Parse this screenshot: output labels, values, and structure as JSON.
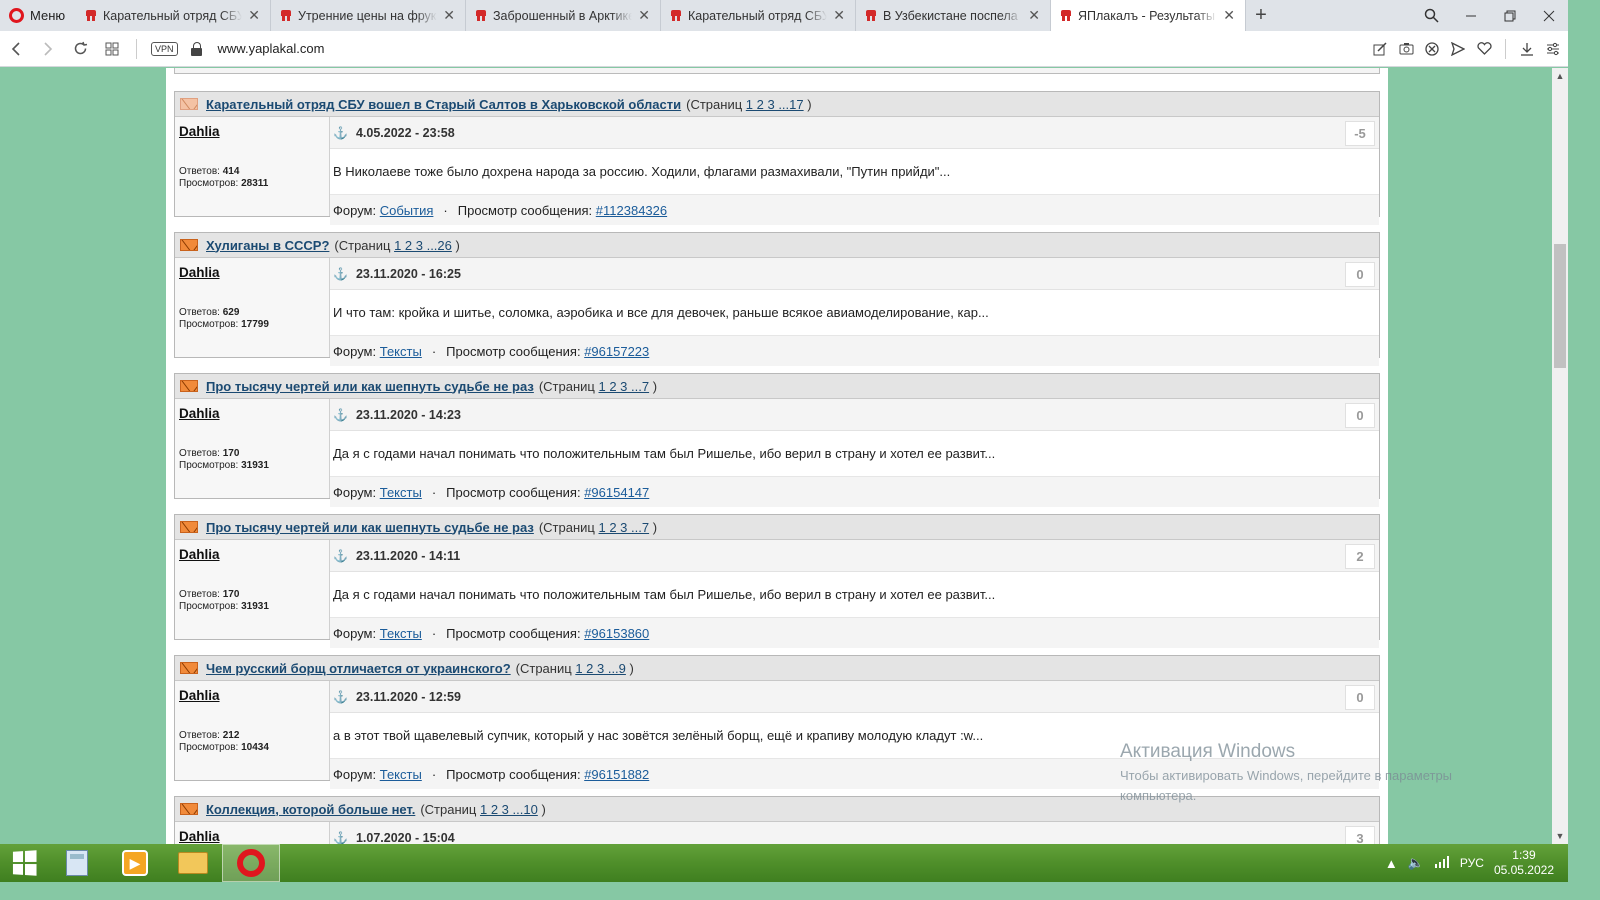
{
  "browser": {
    "menu_label": "Меню",
    "tabs": [
      {
        "title": "Карательный отряд СБУ в",
        "active": false
      },
      {
        "title": "Утренние цены на фрукты",
        "active": false
      },
      {
        "title": "Заброшенный в Арктике",
        "active": false
      },
      {
        "title": "Карательный отряд СБУ в",
        "active": false
      },
      {
        "title": "В Узбекистане поспела по",
        "active": false
      },
      {
        "title": "ЯПлакалъ - Результаты по",
        "active": true
      }
    ],
    "vpn_label": "VPN",
    "url": "www.yaplakal.com"
  },
  "posts": [
    {
      "title": "Карательный отряд СБУ вошел в Старый Салтов в Харьковской области",
      "pages_prefix": "(Страниц",
      "pages": "1 2 3 ...17",
      "pages_suffix": ")",
      "author": "Dahlia",
      "date": "4.05.2022 - 23:58",
      "rating": "-5",
      "replies_label": "Ответов:",
      "replies": "414",
      "views_label": "Просмотров:",
      "views": "28311",
      "text": "В Николаеве тоже было дохрена народа за россию. Ходили, флагами размахивали, \"Путин прийди\"...",
      "forum_label": "Форум:",
      "forum": "События",
      "msg_label": "Просмотр сообщения:",
      "msg_id": "#112384326",
      "icon": "envelope-read"
    },
    {
      "title": "Хулиганы в СССР?",
      "pages_prefix": "(Страниц",
      "pages": "1 2 3 ...26",
      "pages_suffix": ")",
      "author": "Dahlia",
      "date": "23.11.2020 - 16:25",
      "rating": "0",
      "replies_label": "Ответов:",
      "replies": "629",
      "views_label": "Просмотров:",
      "views": "17799",
      "text": "И что там: кройка и шитье, соломка, аэробика и все для девочек, раньше всякое авиамоделирование, кар...",
      "forum_label": "Форум:",
      "forum": "Тексты",
      "msg_label": "Просмотр сообщения:",
      "msg_id": "#96157223",
      "icon": "envelope"
    },
    {
      "title": "Про тысячу чертей или как шепнуть судьбе не раз",
      "pages_prefix": "(Страниц",
      "pages": "1 2 3 ...7",
      "pages_suffix": ")",
      "author": "Dahlia",
      "date": "23.11.2020 - 14:23",
      "rating": "0",
      "replies_label": "Ответов:",
      "replies": "170",
      "views_label": "Просмотров:",
      "views": "31931",
      "text": "Да я с годами начал понимать что положительным там был Ришелье, ибо верил в страну и хотел ее развит...",
      "forum_label": "Форум:",
      "forum": "Тексты",
      "msg_label": "Просмотр сообщения:",
      "msg_id": "#96154147",
      "icon": "envelope"
    },
    {
      "title": "Про тысячу чертей или как шепнуть судьбе не раз",
      "pages_prefix": "(Страниц",
      "pages": "1 2 3 ...7",
      "pages_suffix": ")",
      "author": "Dahlia",
      "date": "23.11.2020 - 14:11",
      "rating": "2",
      "replies_label": "Ответов:",
      "replies": "170",
      "views_label": "Просмотров:",
      "views": "31931",
      "text": "Да я с годами начал понимать что положительным там был Ришелье, ибо верил в страну и хотел ее развит...",
      "forum_label": "Форум:",
      "forum": "Тексты",
      "msg_label": "Просмотр сообщения:",
      "msg_id": "#96153860",
      "icon": "envelope"
    },
    {
      "title": "Чем русский борщ отличается от украинского?",
      "pages_prefix": "(Страниц",
      "pages": "1 2 3 ...9",
      "pages_suffix": ")",
      "author": "Dahlia",
      "date": "23.11.2020 - 12:59",
      "rating": "0",
      "replies_label": "Ответов:",
      "replies": "212",
      "views_label": "Просмотров:",
      "views": "10434",
      "text": "а в этот твой щавелевый супчик, который у нас зовётся зелёный борщ, ещё и крапиву молодую кладут :w...",
      "forum_label": "Форум:",
      "forum": "Тексты",
      "msg_label": "Просмотр сообщения:",
      "msg_id": "#96151882",
      "icon": "envelope"
    },
    {
      "title": "Коллекция, которой больше нет.",
      "pages_prefix": "(Страниц",
      "pages": "1 2 3 ...10",
      "pages_suffix": ")",
      "author": "Dahlia",
      "date": "1.07.2020 - 15:04",
      "rating": "3",
      "icon": "envelope"
    }
  ],
  "watermark": {
    "title": "Активация Windows",
    "subtitle": "Чтобы активировать Windows, перейдите в параметры компьютера."
  },
  "taskbar": {
    "language": "РУС",
    "time": "1:39",
    "date": "05.05.2022"
  }
}
